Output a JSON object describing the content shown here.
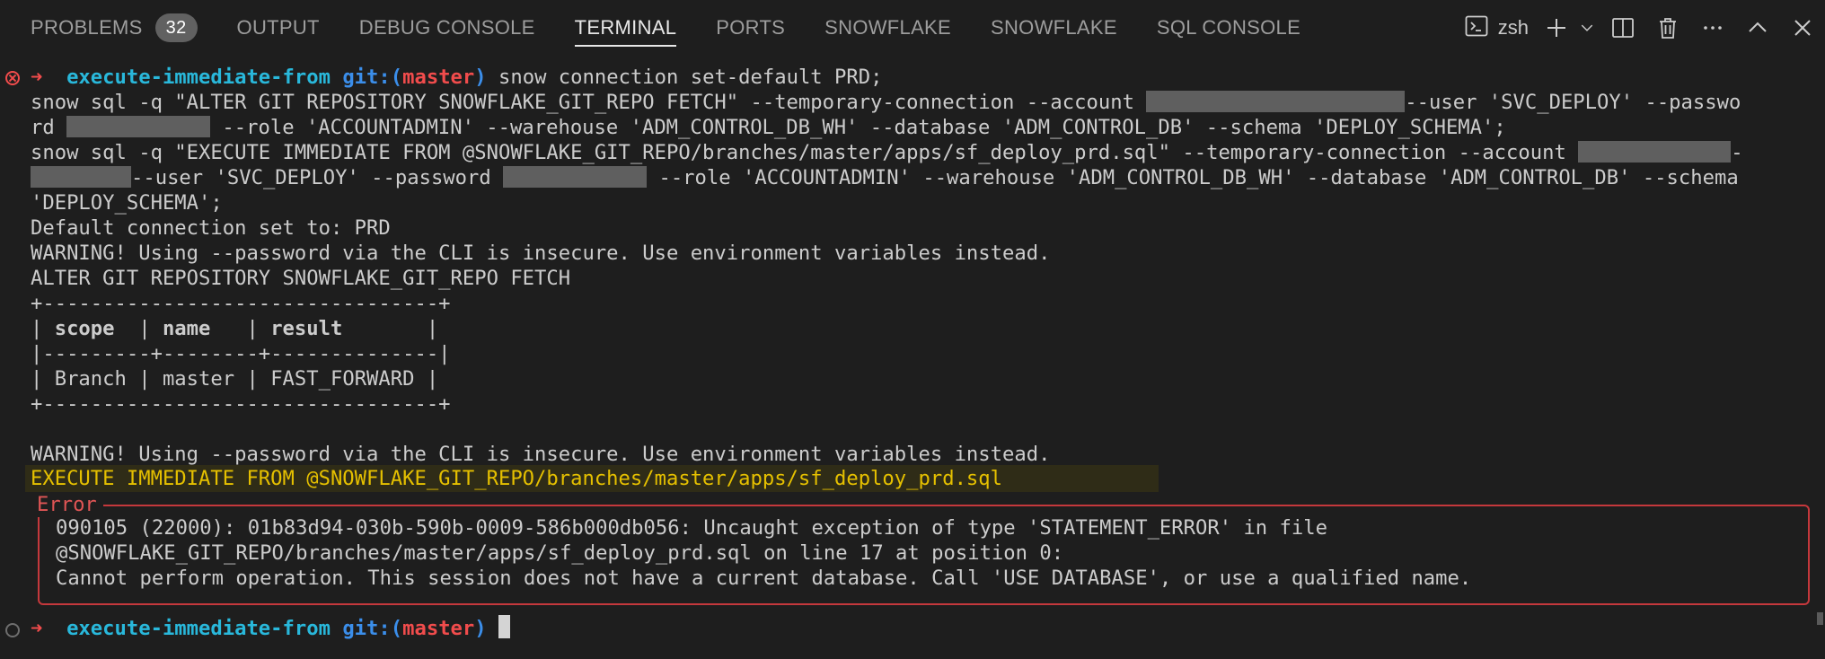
{
  "panel": {
    "tabs": [
      {
        "label": "PROBLEMS",
        "badge": "32"
      },
      {
        "label": "OUTPUT"
      },
      {
        "label": "DEBUG CONSOLE"
      },
      {
        "label": "TERMINAL",
        "active": true
      },
      {
        "label": "PORTS"
      },
      {
        "label": "SNOWFLAKE"
      },
      {
        "label": "SNOWFLAKE"
      },
      {
        "label": "SQL CONSOLE"
      }
    ],
    "shell_name": "zsh",
    "icons": [
      "terminal-icon",
      "plus-icon",
      "chevron-down-icon",
      "split-icon",
      "trash-icon",
      "ellipsis-icon",
      "chevron-up-icon",
      "close-icon"
    ]
  },
  "terminal": {
    "prompt": {
      "arrow": "➜",
      "dir": "execute-immediate-from",
      "git_label": "git:(",
      "branch": "master",
      "git_close": ")"
    },
    "command1": "snow connection set-default PRD;",
    "cmd2_l1a": "snow sql -q \"ALTER GIT REPOSITORY SNOWFLAKE_GIT_REPO FETCH\" --temporary-connection --account ",
    "cmd2_l1b": "--user 'SVC_DEPLOY' --passwo",
    "cmd2_l2a": "rd ",
    "cmd2_l2b": " --role 'ACCOUNTADMIN' --warehouse 'ADM_CONTROL_DB_WH' --database 'ADM_CONTROL_DB' --schema 'DEPLOY_SCHEMA';",
    "cmd3_l1": "snow sql -q \"EXECUTE IMMEDIATE FROM @SNOWFLAKE_GIT_REPO/branches/master/apps/sf_deploy_prd.sql\" --temporary-connection --account ",
    "cmd3_l1_tail": "-",
    "cmd3_l2a": "--user 'SVC_DEPLOY' --password ",
    "cmd3_l2b": " --role 'ACCOUNTADMIN' --warehouse 'ADM_CONTROL_DB_WH' --database 'ADM_CONTROL_DB' --schema",
    "cmd3_l3": "'DEPLOY_SCHEMA';",
    "out_default": "Default connection set to: PRD",
    "out_warning": "WARNING! Using --password via the CLI is insecure. Use environment variables instead.",
    "out_alter": "ALTER GIT REPOSITORY SNOWFLAKE_GIT_REPO FETCH",
    "table": {
      "border": "+---------------------------------+",
      "sep": "|---------+--------+--------------|",
      "headers": [
        "scope",
        "name",
        "result"
      ],
      "row": [
        "Branch",
        "master",
        "FAST_FORWARD"
      ]
    },
    "out_warning2": "WARNING! Using --password via the CLI is insecure. Use environment variables instead.",
    "out_execute": "EXECUTE IMMEDIATE FROM @SNOWFLAKE_GIT_REPO/branches/master/apps/sf_deploy_prd.sql",
    "error": {
      "title": "Error",
      "line1": "090105 (22000): 01b83d94-030b-590b-0009-586b000db056: Uncaught exception of type 'STATEMENT_ERROR' in file",
      "line2": "@SNOWFLAKE_GIT_REPO/branches/master/apps/sf_deploy_prd.sql on line 17 at position 0:",
      "line3": "Cannot perform operation. This session does not have a current database. Call 'USE DATABASE', or use a qualified name."
    }
  },
  "colors": {
    "background": "#1e1e1e",
    "prompt_dir": "#29b8db",
    "prompt_branch": "#f14c4c",
    "highlight": "#e5c000",
    "error_border": "#c5383c"
  }
}
